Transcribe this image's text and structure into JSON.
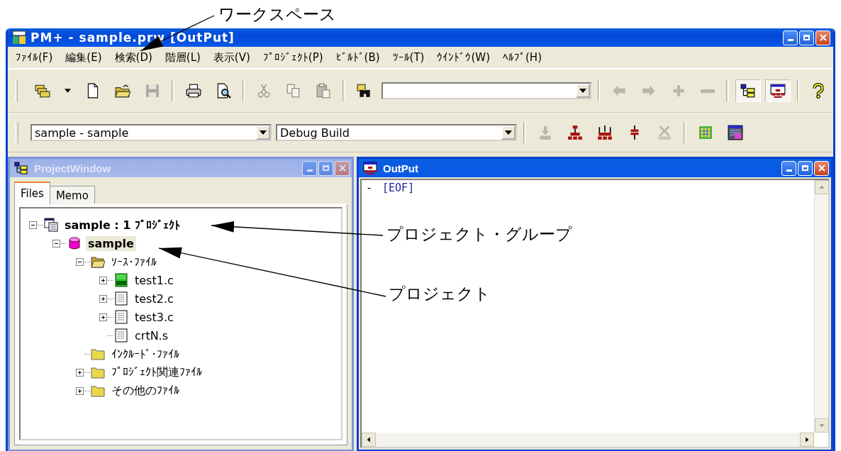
{
  "annotations": [
    {
      "text": "ワークスペース"
    },
    {
      "text": "プロジェクト・グループ"
    },
    {
      "text": "プロジェクト"
    }
  ],
  "window": {
    "title": "PM+ - sample.prw [OutPut]",
    "active": true
  },
  "menu": [
    "ﾌｧｲﾙ(F)",
    "編集(E)",
    "検索(D)",
    "階層(L)",
    "表示(V)",
    "ﾌﾟﾛｼﾞｪｸﾄ(P)",
    "ﾋﾞﾙﾄﾞ(B)",
    "ﾂｰﾙ(T)",
    "ｳｲﾝﾄﾞｳ(W)",
    "ﾍﾙﾌﾟ(H)"
  ],
  "toolbar_1": [
    {
      "kind": "open-workspace",
      "disabled": false,
      "pressed": false
    },
    {
      "kind": "dropdown",
      "disabled": false,
      "pressed": false
    },
    {
      "kind": "new-file",
      "disabled": false,
      "pressed": false
    },
    {
      "kind": "open-file",
      "disabled": false,
      "pressed": false
    },
    {
      "kind": "save",
      "disabled": true,
      "pressed": false
    },
    {
      "kind": "separator"
    },
    {
      "kind": "print",
      "disabled": false,
      "pressed": false
    },
    {
      "kind": "print-preview",
      "disabled": false,
      "pressed": false
    },
    {
      "kind": "separator"
    },
    {
      "kind": "cut",
      "disabled": true,
      "pressed": false
    },
    {
      "kind": "copy",
      "disabled": true,
      "pressed": false
    },
    {
      "kind": "paste",
      "disabled": true,
      "pressed": false
    },
    {
      "kind": "separator"
    },
    {
      "kind": "find",
      "disabled": false,
      "pressed": false
    },
    {
      "kind": "combo"
    },
    {
      "kind": "separator"
    },
    {
      "kind": "back",
      "disabled": true,
      "pressed": false
    },
    {
      "kind": "forward",
      "disabled": true,
      "pressed": false
    },
    {
      "kind": "add",
      "disabled": true,
      "pressed": false
    },
    {
      "kind": "remove",
      "disabled": true,
      "pressed": false
    },
    {
      "kind": "separator"
    },
    {
      "kind": "project-window",
      "disabled": false,
      "pressed": true
    },
    {
      "kind": "output-window",
      "disabled": false,
      "pressed": true
    },
    {
      "kind": "separator"
    },
    {
      "kind": "help",
      "disabled": false,
      "pressed": false
    }
  ],
  "toolbar_2": [
    {
      "kind": "combo",
      "value": "sample - sample"
    },
    {
      "kind": "combo",
      "value": "Debug Build"
    },
    {
      "kind": "separator"
    },
    {
      "kind": "download",
      "disabled": true,
      "pressed": false
    },
    {
      "kind": "build",
      "disabled": false,
      "pressed": false
    },
    {
      "kind": "rebuild",
      "disabled": false,
      "pressed": false
    },
    {
      "kind": "compile",
      "disabled": false,
      "pressed": false
    },
    {
      "kind": "clean",
      "disabled": true,
      "pressed": false
    },
    {
      "kind": "separator"
    },
    {
      "kind": "chip",
      "disabled": false,
      "pressed": false
    },
    {
      "kind": "window-grid",
      "disabled": false,
      "pressed": false
    }
  ],
  "project_window": {
    "title": "ProjectWindow",
    "active": false,
    "tabs": [
      {
        "label": "Files",
        "selected": true
      },
      {
        "label": "Memo",
        "selected": false
      }
    ],
    "tree": [
      {
        "label": "sample : 1 ﾌﾟﾛｼﾞｪｸﾄ",
        "kind": "group",
        "expanded": true,
        "selected": false,
        "children": [
          {
            "label": "sample",
            "kind": "project",
            "expanded": true,
            "selected": true,
            "children": [
              {
                "label": "ｿｰｽ･ﾌｧｲﾙ",
                "kind": "folder",
                "expanded": true,
                "selected": false,
                "children": [
                  {
                    "label": "test1.c",
                    "kind": "dpt-file",
                    "expanded": false,
                    "selected": false
                  },
                  {
                    "label": "test2.c",
                    "kind": "file",
                    "expanded": false,
                    "selected": false
                  },
                  {
                    "label": "test3.c",
                    "kind": "file",
                    "expanded": false,
                    "selected": false
                  },
                  {
                    "label": "crtN.s",
                    "kind": "file",
                    "selected": false
                  }
                ]
              },
              {
                "label": "ｲﾝｸﾙｰﾄﾞ･ﾌｧｲﾙ",
                "kind": "folder",
                "selected": false
              },
              {
                "label": "ﾌﾟﾛｼﾞｪｸﾄ関連ﾌｧｲﾙ",
                "kind": "folder",
                "expanded": false,
                "selected": false
              },
              {
                "label": "その他のﾌｧｲﾙ",
                "kind": "folder",
                "expanded": false,
                "selected": false
              }
            ]
          }
        ]
      }
    ]
  },
  "output_window": {
    "title": "OutPut",
    "active": true,
    "lines": [
      {
        "marker": "-",
        "text": "[EOF]"
      }
    ]
  }
}
